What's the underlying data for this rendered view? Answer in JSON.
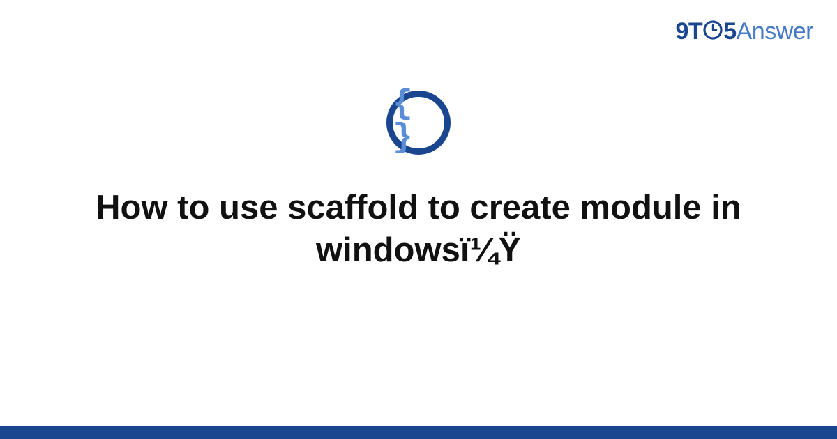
{
  "logo": {
    "nine": "9",
    "t": "T",
    "five": "5",
    "answer": "Answer"
  },
  "center_icon": {
    "braces": "{ }"
  },
  "title": "How to use scaffold to create module in windowsï¼Ÿ",
  "colors": {
    "dark_blue": "#19468e",
    "light_blue": "#4679c6",
    "brace_blue": "#5a8dd6"
  }
}
